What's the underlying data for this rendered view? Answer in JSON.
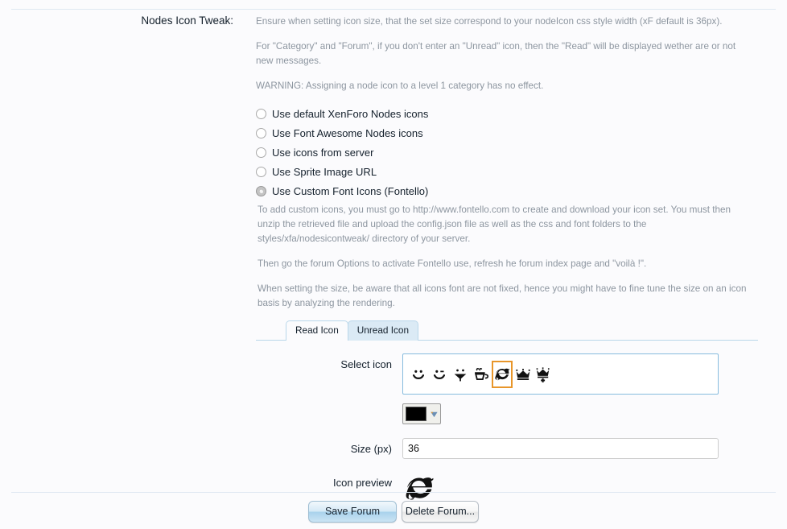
{
  "page": {
    "background": "#fbfbfd",
    "accent_selected": "#e8962a",
    "tab_border": "#b9d7ea"
  },
  "form": {
    "label": "Nodes Icon Tweak:",
    "descriptions": [
      "Ensure when setting icon size, that the set size correspond to your nodeIcon css style width (xF default is 36px).",
      "For \"Category\" and \"Forum\", if you don't enter an \"Unread\" icon, then the \"Read\" will be displayed wether are or not new messages.",
      "WARNING: Assigning a node icon to a level 1 category has no effect."
    ],
    "options": [
      {
        "label": "Use default XenForo Nodes icons",
        "checked": false
      },
      {
        "label": "Use Font Awesome Nodes icons",
        "checked": false
      },
      {
        "label": "Use icons from server",
        "checked": false
      },
      {
        "label": "Use Sprite Image URL",
        "checked": false
      },
      {
        "label": "Use Custom Font Icons (Fontello)",
        "checked": true
      }
    ],
    "fontello_notes": [
      "To add custom icons, you must go to http://www.fontello.com to create and download your icon set. You must then unzip the retrieved file and upload the config.json file as well as the css and font folders to the styles/xfa/nodesicontweak/ directory of your server.",
      "Then go the forum Options to activate Fontello use, refresh he forum index page and \"voilà !\".",
      "When setting the size, be aware that all icons font are not fixed, hence you might have to fine tune the size on an icon basis by analyzing the rendering."
    ],
    "tabs": [
      {
        "label": "Read Icon",
        "active": true
      },
      {
        "label": "Unread Icon",
        "active": false
      }
    ],
    "select_icon": {
      "label": "Select icon",
      "glyphs": [
        {
          "name": "smiley-icon",
          "selected": false
        },
        {
          "name": "smiley-wink-icon",
          "selected": false
        },
        {
          "name": "umbrella-icon",
          "selected": false
        },
        {
          "name": "coffee-cup-icon",
          "selected": false
        },
        {
          "name": "internet-explorer-icon",
          "selected": true
        },
        {
          "name": "crown-icon",
          "selected": false
        },
        {
          "name": "crown-plus-icon",
          "selected": false
        }
      ]
    },
    "color": {
      "name": "icon-color-picker",
      "value": "#000000"
    },
    "size": {
      "label": "Size (px)",
      "value": "36",
      "placeholder": ""
    },
    "preview": {
      "label": "Icon preview",
      "icon": "internet-explorer-icon"
    }
  },
  "footer": {
    "save_label": "Save Forum",
    "delete_label": "Delete Forum..."
  }
}
